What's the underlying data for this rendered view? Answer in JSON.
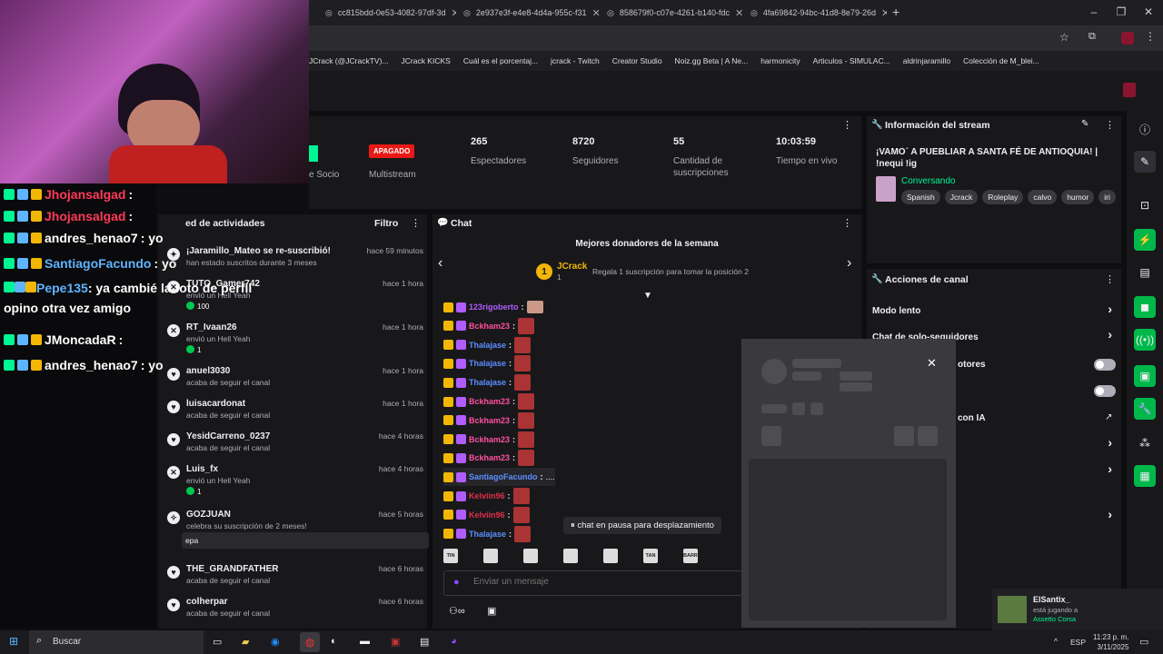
{
  "browser": {
    "tabs": [
      {
        "label": "cc815bdd-0e53-4082-97df-3d"
      },
      {
        "label": "2e937e3f-e4e8-4d4a-955c-f31"
      },
      {
        "label": "858679f0-c07e-4261-b140-fdc"
      },
      {
        "label": "4fa69842-94bc-41d8-8e79-26d"
      }
    ],
    "new_tab": "+",
    "bookmarks": [
      "JCrack (@JCrackTV)...",
      "JCrack KICKS",
      "Cuál es el porcentaj...",
      "jcrack - Twitch",
      "Creator Studio",
      "Noiz.gg Beta | A Ne...",
      "harmonicity",
      "Articulos - SIMULAC...",
      "aldrinjaramillo",
      "Colección de M_blei..."
    ]
  },
  "stats": {
    "partner_label": "e Socio",
    "multistream_badge": "APAGADO",
    "multistream_label": "Multistream",
    "viewers_value": "265",
    "viewers_label": "Espectadores",
    "followers_value": "8720",
    "followers_label": "Seguidores",
    "subs_value": "55",
    "subs_label": "Cantidad de suscripciones",
    "uptime_value": "10:03:59",
    "uptime_label": "Tiempo en vivo"
  },
  "feed": {
    "title": "ed de actividades",
    "filter": "Filtro",
    "items": [
      {
        "name": "¡Jaramillo_Mateo se re-suscribió!",
        "sub": "han estado suscritos durante 3 meses",
        "time": "hace 59 minutos"
      },
      {
        "name": "TUTO_Gamer742",
        "sub": "envió un Hell Yeah",
        "time": "hace 1 hora",
        "gift": "100"
      },
      {
        "name": "RT_Ivaan26",
        "sub": "envió un Hell Yeah",
        "time": "hace 1 hora",
        "gift": "1"
      },
      {
        "name": "anuel3030",
        "sub": "acaba de seguir el canal",
        "time": "hace 1 hora"
      },
      {
        "name": "luisacardonat",
        "sub": "acaba de seguir el canal",
        "time": "hace 1 hora"
      },
      {
        "name": "YesidCarreno_0237",
        "sub": "acaba de seguir el canal",
        "time": "hace 4 horas"
      },
      {
        "name": "Luis_fx",
        "sub": "envió un Hell Yeah",
        "time": "hace 4 horas",
        "gift": "1"
      },
      {
        "name": "GOZJUAN",
        "sub": "celebra su suscripción de 2 meses!",
        "time": "hace 5 horas",
        "msg": "epa"
      },
      {
        "name": "THE_GRANDFATHER",
        "sub": "acaba de seguir el canal",
        "time": "hace 6 horas"
      },
      {
        "name": "colherpar",
        "sub": "acaba de seguir el canal",
        "time": "hace 6 horas"
      }
    ]
  },
  "chat": {
    "title": "Chat",
    "donors_title": "Mejores donadores de la semana",
    "top_donor": "JCrack",
    "top_count": "1",
    "rank": "1",
    "regala": "Regala 1 suscripción para tomar la posición 2",
    "lines": [
      {
        "user": "123rigoberto",
        "color": "#b05cff"
      },
      {
        "user": "Bckham23",
        "color": "#ff4fa0"
      },
      {
        "user": "Thalajase",
        "color": "#5c8dff"
      },
      {
        "user": "Thalajase",
        "color": "#5c8dff"
      },
      {
        "user": "Thalajase",
        "color": "#5c8dff"
      },
      {
        "user": "Bckham23",
        "color": "#ff4fa0"
      },
      {
        "user": "Bckham23",
        "color": "#ff4fa0"
      },
      {
        "user": "Bckham23",
        "color": "#ff4fa0"
      },
      {
        "user": "Bckham23",
        "color": "#ff4fa0"
      },
      {
        "user": "SantiagoFacundo",
        "color": "#5c8dff",
        "text": "...."
      },
      {
        "user": "Kelviin96",
        "color": "#e0304a"
      },
      {
        "user": "Kelviin96",
        "color": "#e0304a"
      },
      {
        "user": "Thalajase",
        "color": "#5c8dff"
      }
    ],
    "paused": "chat en pausa para desplazamiento",
    "emotes": [
      "TIN",
      "",
      "",
      "",
      "",
      "TAN",
      "BARRO BARRO"
    ],
    "placeholder": "Enviar un mensaje"
  },
  "info": {
    "title": "Información del stream",
    "stream_title": "¡VAMO´ A PUEBLIAR A SANTA FÉ DE ANTIOQUIA! | !nequi !ig",
    "category": "Conversando",
    "tags": [
      "Spanish",
      "Jcrack",
      "Roleplay",
      "calvo",
      "humor",
      "iri"
    ]
  },
  "actions": {
    "title": "Acciones de canal",
    "rows": [
      "Modo lento",
      "Chat de solo-seguidores",
      "otores",
      "",
      "con IA"
    ]
  },
  "overlay_chat": [
    {
      "user": "Jhojansalgad",
      "text": ":",
      "color": "#ff3a5a"
    },
    {
      "user": "Jhojansalgad",
      "text": ":",
      "color": "#ff3a5a"
    },
    {
      "user": "andres_henao7",
      "text": ": yo",
      "color": "#ffffff"
    },
    {
      "user": "SantiagoFacundo",
      "text": ": yo",
      "color": "#5fb4ff"
    },
    {
      "user": "Pepe135",
      "text": ": ya cambié la foto de perfil opino otra vez amigo",
      "color": "#5fb4ff"
    },
    {
      "user": "JMoncadaR",
      "text": ":",
      "color": "#ffffff"
    },
    {
      "user": "andres_henao7",
      "text": ": yo",
      "color": "#ffffff"
    }
  ],
  "notification": {
    "name": "ElSantix_",
    "line1": "está jugando a",
    "line2": "Assetto Corsa"
  },
  "taskbar": {
    "search": "Buscar",
    "lang": "ESP",
    "time": "11:23 p. m.",
    "date": "3/11/2025"
  },
  "colors": {
    "accent": "#00f593",
    "twitch": "#9147ff",
    "danger": "#e91916"
  }
}
